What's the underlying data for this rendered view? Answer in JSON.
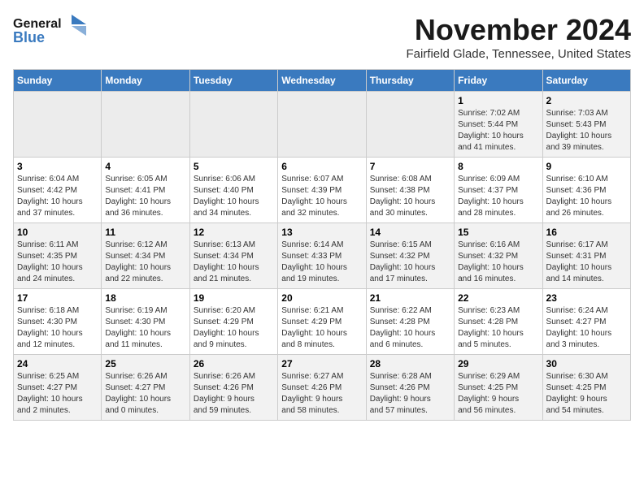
{
  "header": {
    "logo_general": "General",
    "logo_blue": "Blue",
    "month_year": "November 2024",
    "location": "Fairfield Glade, Tennessee, United States"
  },
  "days_of_week": [
    "Sunday",
    "Monday",
    "Tuesday",
    "Wednesday",
    "Thursday",
    "Friday",
    "Saturday"
  ],
  "weeks": [
    [
      {
        "day": "",
        "info": ""
      },
      {
        "day": "",
        "info": ""
      },
      {
        "day": "",
        "info": ""
      },
      {
        "day": "",
        "info": ""
      },
      {
        "day": "",
        "info": ""
      },
      {
        "day": "1",
        "info": "Sunrise: 7:02 AM\nSunset: 5:44 PM\nDaylight: 10 hours\nand 41 minutes."
      },
      {
        "day": "2",
        "info": "Sunrise: 7:03 AM\nSunset: 5:43 PM\nDaylight: 10 hours\nand 39 minutes."
      }
    ],
    [
      {
        "day": "3",
        "info": "Sunrise: 6:04 AM\nSunset: 4:42 PM\nDaylight: 10 hours\nand 37 minutes."
      },
      {
        "day": "4",
        "info": "Sunrise: 6:05 AM\nSunset: 4:41 PM\nDaylight: 10 hours\nand 36 minutes."
      },
      {
        "day": "5",
        "info": "Sunrise: 6:06 AM\nSunset: 4:40 PM\nDaylight: 10 hours\nand 34 minutes."
      },
      {
        "day": "6",
        "info": "Sunrise: 6:07 AM\nSunset: 4:39 PM\nDaylight: 10 hours\nand 32 minutes."
      },
      {
        "day": "7",
        "info": "Sunrise: 6:08 AM\nSunset: 4:38 PM\nDaylight: 10 hours\nand 30 minutes."
      },
      {
        "day": "8",
        "info": "Sunrise: 6:09 AM\nSunset: 4:37 PM\nDaylight: 10 hours\nand 28 minutes."
      },
      {
        "day": "9",
        "info": "Sunrise: 6:10 AM\nSunset: 4:36 PM\nDaylight: 10 hours\nand 26 minutes."
      }
    ],
    [
      {
        "day": "10",
        "info": "Sunrise: 6:11 AM\nSunset: 4:35 PM\nDaylight: 10 hours\nand 24 minutes."
      },
      {
        "day": "11",
        "info": "Sunrise: 6:12 AM\nSunset: 4:34 PM\nDaylight: 10 hours\nand 22 minutes."
      },
      {
        "day": "12",
        "info": "Sunrise: 6:13 AM\nSunset: 4:34 PM\nDaylight: 10 hours\nand 21 minutes."
      },
      {
        "day": "13",
        "info": "Sunrise: 6:14 AM\nSunset: 4:33 PM\nDaylight: 10 hours\nand 19 minutes."
      },
      {
        "day": "14",
        "info": "Sunrise: 6:15 AM\nSunset: 4:32 PM\nDaylight: 10 hours\nand 17 minutes."
      },
      {
        "day": "15",
        "info": "Sunrise: 6:16 AM\nSunset: 4:32 PM\nDaylight: 10 hours\nand 16 minutes."
      },
      {
        "day": "16",
        "info": "Sunrise: 6:17 AM\nSunset: 4:31 PM\nDaylight: 10 hours\nand 14 minutes."
      }
    ],
    [
      {
        "day": "17",
        "info": "Sunrise: 6:18 AM\nSunset: 4:30 PM\nDaylight: 10 hours\nand 12 minutes."
      },
      {
        "day": "18",
        "info": "Sunrise: 6:19 AM\nSunset: 4:30 PM\nDaylight: 10 hours\nand 11 minutes."
      },
      {
        "day": "19",
        "info": "Sunrise: 6:20 AM\nSunset: 4:29 PM\nDaylight: 10 hours\nand 9 minutes."
      },
      {
        "day": "20",
        "info": "Sunrise: 6:21 AM\nSunset: 4:29 PM\nDaylight: 10 hours\nand 8 minutes."
      },
      {
        "day": "21",
        "info": "Sunrise: 6:22 AM\nSunset: 4:28 PM\nDaylight: 10 hours\nand 6 minutes."
      },
      {
        "day": "22",
        "info": "Sunrise: 6:23 AM\nSunset: 4:28 PM\nDaylight: 10 hours\nand 5 minutes."
      },
      {
        "day": "23",
        "info": "Sunrise: 6:24 AM\nSunset: 4:27 PM\nDaylight: 10 hours\nand 3 minutes."
      }
    ],
    [
      {
        "day": "24",
        "info": "Sunrise: 6:25 AM\nSunset: 4:27 PM\nDaylight: 10 hours\nand 2 minutes."
      },
      {
        "day": "25",
        "info": "Sunrise: 6:26 AM\nSunset: 4:27 PM\nDaylight: 10 hours\nand 0 minutes."
      },
      {
        "day": "26",
        "info": "Sunrise: 6:26 AM\nSunset: 4:26 PM\nDaylight: 9 hours\nand 59 minutes."
      },
      {
        "day": "27",
        "info": "Sunrise: 6:27 AM\nSunset: 4:26 PM\nDaylight: 9 hours\nand 58 minutes."
      },
      {
        "day": "28",
        "info": "Sunrise: 6:28 AM\nSunset: 4:26 PM\nDaylight: 9 hours\nand 57 minutes."
      },
      {
        "day": "29",
        "info": "Sunrise: 6:29 AM\nSunset: 4:25 PM\nDaylight: 9 hours\nand 56 minutes."
      },
      {
        "day": "30",
        "info": "Sunrise: 6:30 AM\nSunset: 4:25 PM\nDaylight: 9 hours\nand 54 minutes."
      }
    ]
  ]
}
